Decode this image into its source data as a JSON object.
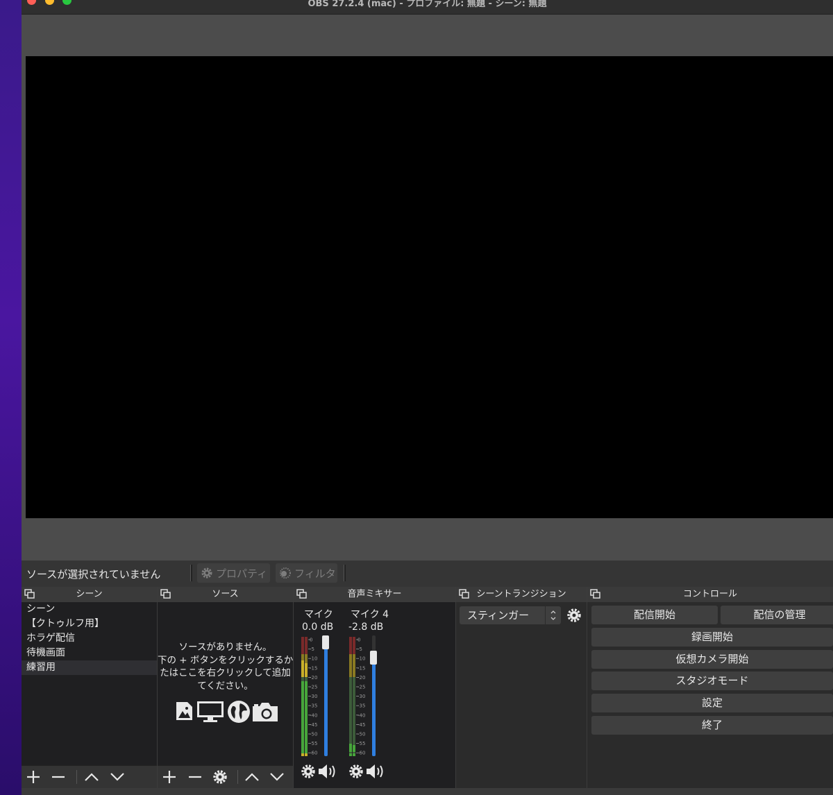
{
  "window": {
    "title": "OBS 27.2.4 (mac) - プロファイル: 無題 - シーン: 無題"
  },
  "source_toolbar": {
    "no_source_text": "ソースが選択されていません",
    "properties_label": "プロパティ",
    "filters_label": "フィルタ"
  },
  "scenes": {
    "header": "シーン",
    "items": [
      "シーン",
      "【クトゥルフ用】",
      "ホラゲ配信",
      "待機画面",
      "練習用"
    ],
    "selected_index": 4
  },
  "sources": {
    "header": "ソース",
    "empty_line1": "ソースがありません。",
    "empty_line2": "下の + ボタンをクリックするか、",
    "empty_line3": "たはここを右クリックして追加",
    "empty_line4": "てください。"
  },
  "mixer": {
    "header": "音声ミキサー",
    "channels": [
      {
        "name": "マイク",
        "db": "0.0 dB",
        "volume_fraction": 0.98
      },
      {
        "name": "マイク 4",
        "db": "-2.8 dB",
        "volume_fraction": 0.85
      }
    ],
    "scale": [
      "0",
      "-5",
      "-10",
      "-15",
      "-20",
      "-25",
      "-30",
      "-35",
      "-40",
      "-45",
      "-50",
      "-55",
      "-60"
    ]
  },
  "transitions": {
    "header": "シーントランジション",
    "selected": "スティンガー"
  },
  "controls": {
    "header": "コントロール",
    "start_streaming": "配信開始",
    "manage_broadcast": "配信の管理",
    "start_recording": "録画開始",
    "start_virtual_camera": "仮想カメラ開始",
    "studio_mode": "スタジオモード",
    "settings": "設定",
    "exit": "終了"
  },
  "colors": {
    "close": "#ff5f57",
    "minimize": "#febc2e",
    "zoom": "#28c840",
    "slider_blue": "#2f7fe0",
    "meter_green": "#47a63b",
    "meter_yellow": "#c9b02a",
    "meter_red": "#a63232"
  }
}
